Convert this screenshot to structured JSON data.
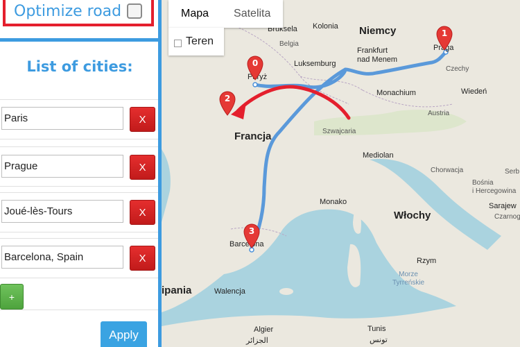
{
  "panel": {
    "optimize_label": "Optimize road",
    "optimize_checked": false,
    "list_title": "List of cities:",
    "cities": [
      {
        "value": "Paris",
        "remove_label": "X"
      },
      {
        "value": "Prague",
        "remove_label": "X"
      },
      {
        "value": "Joué-lès-Tours",
        "remove_label": "X"
      },
      {
        "value": "Barcelona, Spain",
        "remove_label": "X"
      }
    ],
    "add_label": "+",
    "apply_label": "Apply"
  },
  "map": {
    "map_types": [
      "Mapa",
      "Satelita"
    ],
    "active_map_type": "Mapa",
    "terrain_label": "Teren",
    "route_color": "#4a90d9",
    "annotation_arrow_color": "#e41f2d",
    "marker_color": "#e53935",
    "markers": [
      "0",
      "1",
      "2",
      "3"
    ],
    "labels": {
      "bruksela": "Bruksela",
      "kolonia": "Kolonia",
      "belgia": "Belgia",
      "niemcy": "Niemcy",
      "praga": "Praga",
      "luksemburg": "Luksemburg",
      "frankfurt": "Frankfurt\nnad Menem",
      "paryz": "Paryż",
      "czechy": "Czechy",
      "monachium": "Monachium",
      "wieden": "Wiedeń",
      "austria": "Austria",
      "szwajcaria": "Szwajcaria",
      "francja": "Francja",
      "mediolan": "Mediolan",
      "chorwacja": "Chorwacja",
      "bosnia": "Bośnia\ni Hercegowina",
      "serbia": "Serb",
      "sarajewo": "Sarajew",
      "czarnog": "Czarnog",
      "monako": "Monako",
      "wlochy": "Włochy",
      "barcelona": "Barcelona",
      "rzym": "Rzym",
      "hiszpania": "ipania",
      "walencja": "Walencja",
      "morze_tyrrenskie": "Morze\nTyrreńskie",
      "algier": "Algier",
      "algier_ar": "الجزائر",
      "tunis": "Tunis",
      "tunis_ar": "تونس"
    }
  }
}
